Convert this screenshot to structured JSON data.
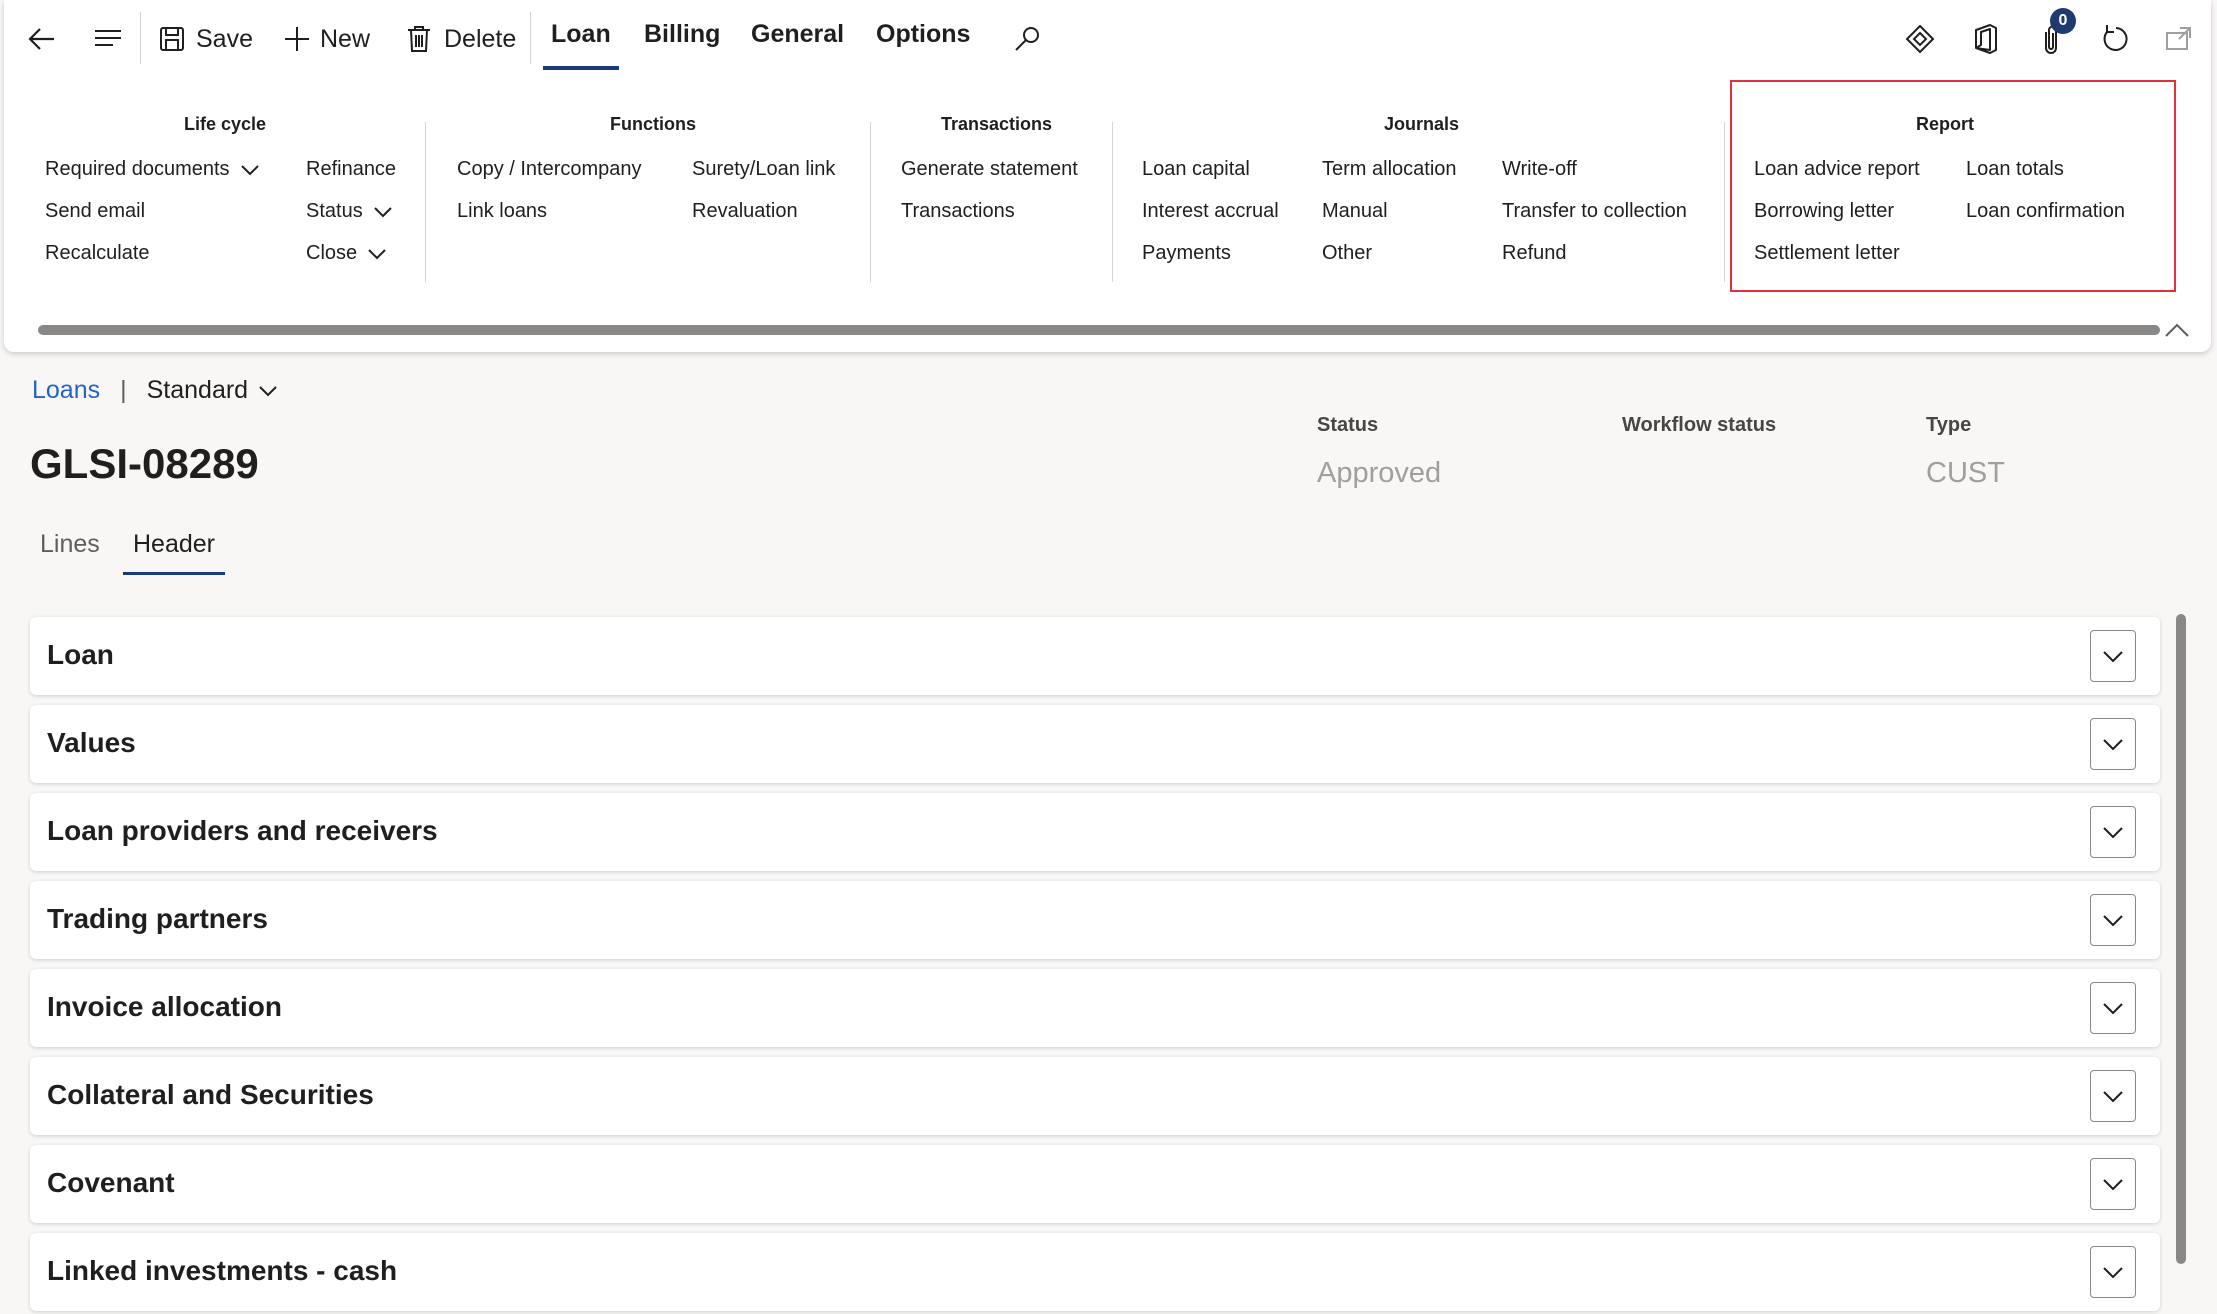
{
  "toolbar": {
    "save_label": "Save",
    "new_label": "New",
    "delete_label": "Delete",
    "tabs": [
      {
        "label": "Loan",
        "active": true
      },
      {
        "label": "Billing",
        "active": false
      },
      {
        "label": "General",
        "active": false
      },
      {
        "label": "Options",
        "active": false
      }
    ],
    "attachments_count": "0",
    "icons": [
      "back-icon",
      "menu-icon",
      "save-icon",
      "plus-icon",
      "trash-icon",
      "search-icon",
      "diamond-icon",
      "office-icon",
      "attachment-icon",
      "refresh-icon",
      "open-new-window-icon"
    ]
  },
  "ribbon": {
    "lifecycle": {
      "title": "Life cycle",
      "required_documents": "Required documents",
      "send_email": "Send email",
      "recalculate": "Recalculate",
      "refinance": "Refinance",
      "status": "Status",
      "close": "Close"
    },
    "functions": {
      "title": "Functions",
      "copy_intercompany": "Copy / Intercompany",
      "link_loans": "Link loans",
      "surety_loan_link": "Surety/Loan link",
      "revaluation": "Revaluation"
    },
    "transactions": {
      "title": "Transactions",
      "generate_statement": "Generate statement",
      "transactions": "Transactions"
    },
    "journals": {
      "title": "Journals",
      "loan_capital": "Loan capital",
      "interest_accrual": "Interest accrual",
      "payments": "Payments",
      "term_allocation": "Term allocation",
      "manual": "Manual",
      "other": "Other",
      "write_off": "Write-off",
      "transfer_to_collection": "Transfer to collection",
      "refund": "Refund"
    },
    "report": {
      "title": "Report",
      "loan_advice_report": "Loan advice report",
      "borrowing_letter": "Borrowing letter",
      "settlement_letter": "Settlement letter",
      "loan_totals": "Loan totals",
      "loan_confirmation": "Loan confirmation"
    }
  },
  "breadcrumb": {
    "link": "Loans",
    "separator": "|",
    "view": "Standard"
  },
  "record": {
    "title": "GLSI-08289"
  },
  "summary": {
    "status_label": "Status",
    "status_value": "Approved",
    "workflow_label": "Workflow status",
    "workflow_value": "",
    "type_label": "Type",
    "type_value": "CUST"
  },
  "page_tabs": [
    {
      "label": "Lines",
      "active": false
    },
    {
      "label": "Header",
      "active": true
    }
  ],
  "fasttabs": [
    "Loan",
    "Values",
    "Loan providers and receivers",
    "Trading partners",
    "Invoice allocation",
    "Collateral and Securities",
    "Covenant",
    "Linked investments - cash"
  ],
  "colors": {
    "accent": "#1a3a7a",
    "link": "#2464c8",
    "highlight_box": "#e0303a",
    "muted_value": "#a19f9d"
  }
}
